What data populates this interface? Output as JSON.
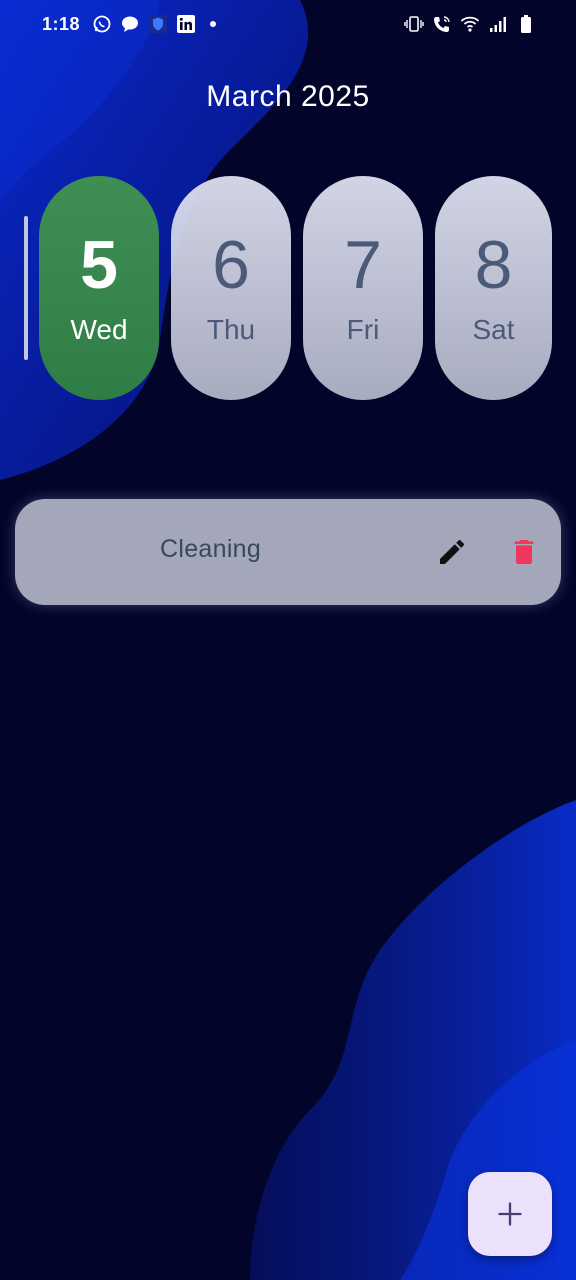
{
  "status_bar": {
    "time": "1:18",
    "left_icons": [
      "whatsapp-icon",
      "message-icon",
      "shield-app-icon",
      "linkedin-icon",
      "notification-dot-icon"
    ],
    "right_icons": [
      "vibrate-icon",
      "wifi-calling-icon",
      "wifi-icon",
      "signal-icon",
      "battery-icon"
    ]
  },
  "header": {
    "month_label": "March 2025"
  },
  "days": [
    {
      "number": "5",
      "name": "Wed",
      "selected": true
    },
    {
      "number": "6",
      "name": "Thu",
      "selected": false
    },
    {
      "number": "7",
      "name": "Fri",
      "selected": false
    },
    {
      "number": "8",
      "name": "Sat",
      "selected": false
    }
  ],
  "tasks": [
    {
      "title": "Cleaning",
      "actions": [
        "edit-icon",
        "delete-icon"
      ]
    }
  ],
  "fab": {
    "icon": "plus-icon"
  },
  "colors": {
    "background": "#03042a",
    "wave": "#0a2bd6",
    "selected_day": "#3a8a50",
    "day_pill": "#c9ccdc",
    "task_card": "#b2b5c5",
    "delete": "#f0365a",
    "fab": "#ece1fb"
  }
}
